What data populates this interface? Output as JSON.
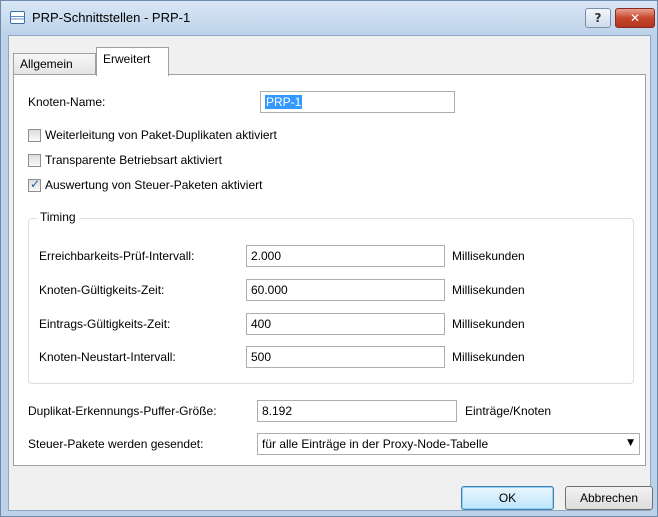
{
  "window": {
    "title": "PRP-Schnittstellen - PRP-1",
    "help_label": "?",
    "close_label": "✕"
  },
  "tabs": [
    {
      "label": "Allgemein"
    },
    {
      "label": "Erweitert"
    }
  ],
  "form": {
    "node_name_label": "Knoten-Name:",
    "node_name_value": "PRP-1",
    "checkboxes": [
      {
        "label": "Weiterleitung von Paket-Duplikaten aktiviert",
        "checked": false
      },
      {
        "label": "Transparente Betriebsart aktiviert",
        "checked": false
      },
      {
        "label": "Auswertung von Steuer-Paketen aktiviert",
        "checked": true
      }
    ],
    "check_glyph": "✓",
    "timing": {
      "title": "Timing",
      "rows": [
        {
          "label": "Erreichbarkeits-Prüf-Intervall:",
          "value": "2.000",
          "unit": "Millisekunden"
        },
        {
          "label": "Knoten-Gültigkeits-Zeit:",
          "value": "60.000",
          "unit": "Millisekunden"
        },
        {
          "label": "Eintrags-Gültigkeits-Zeit:",
          "value": "400",
          "unit": "Millisekunden"
        },
        {
          "label": "Knoten-Neustart-Intervall:",
          "value": "500",
          "unit": "Millisekunden"
        }
      ]
    },
    "buffer_label": "Duplikat-Erkennungs-Puffer-Größe:",
    "buffer_value": "8.192",
    "buffer_unit": "Einträge/Knoten",
    "control_label": "Steuer-Pakete werden gesendet:",
    "control_value": "für alle Einträge in der Proxy-Node-Tabelle",
    "dropdown_glyph": "▼"
  },
  "buttons": {
    "ok": "OK",
    "cancel": "Abbrechen"
  }
}
